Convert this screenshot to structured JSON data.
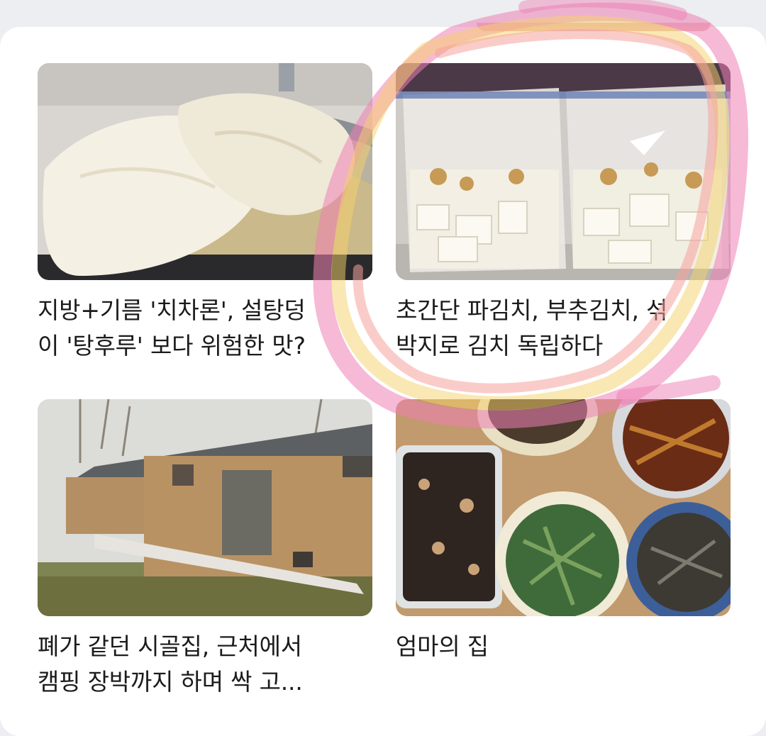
{
  "feed": {
    "articles": [
      {
        "title": "지방+기름 '치차론', 설탕덩\n이 '탕후루' 보다 위험한 맛?",
        "image": "fried-pork-rind-in-bowl"
      },
      {
        "title": "초간단 파김치, 부추김치, 섞\n박지로 김치 독립하다",
        "image": "radish-kimchi-in-zip-bags"
      },
      {
        "title": "폐가 같던 시골집, 근처에서\n캠핑 장박까지 하며 싹 고...",
        "image": "old-rural-house"
      },
      {
        "title": "엄마의 집",
        "image": "side-dishes-in-containers"
      }
    ]
  },
  "annotation": {
    "colors": [
      "#ee7fb4",
      "#f6d26a",
      "#f5a29c"
    ]
  }
}
